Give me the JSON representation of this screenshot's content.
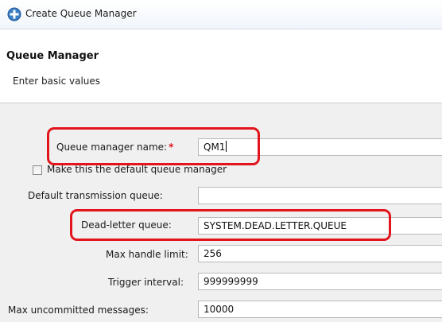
{
  "window": {
    "title": "Create Queue Manager",
    "icon": "queue-manager-create-icon"
  },
  "page": {
    "heading": "Queue Manager",
    "subtitle": "Enter basic values"
  },
  "form": {
    "queue_manager_name": {
      "label": "Queue manager name:",
      "required_marker": "*",
      "value": "QM1"
    },
    "default_checkbox": {
      "label": "Make this the default queue manager",
      "checked": false
    },
    "default_transmission_queue": {
      "label": "Default transmission queue:",
      "value": ""
    },
    "dead_letter_queue": {
      "label": "Dead-letter queue:",
      "value": "SYSTEM.DEAD.LETTER.QUEUE"
    },
    "max_handle_limit": {
      "label": "Max handle limit:",
      "value": "256"
    },
    "trigger_interval": {
      "label": "Trigger interval:",
      "value": "999999999"
    },
    "max_uncommitted_messages": {
      "label": "Max uncommitted messages:",
      "value": "10000"
    }
  },
  "colors": {
    "highlight": "#e2151d",
    "required": "#e0101a",
    "title_icon": "#3b7dc4"
  }
}
